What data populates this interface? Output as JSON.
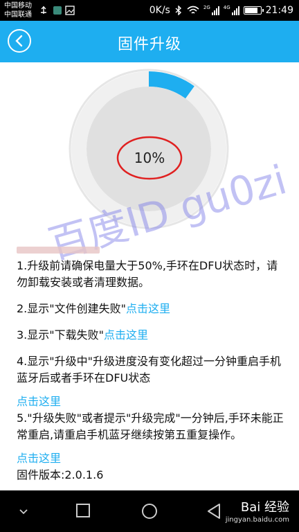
{
  "status_bar": {
    "carrier_1": "中国移动",
    "carrier_2": "中国联通",
    "speed": "0K/s",
    "network_1": "2G",
    "network_2": "4G",
    "time": "21:49",
    "battery_fill": 0.75
  },
  "header": {
    "title": "固件升级",
    "back_icon": "chevron-left-icon",
    "accent_color": "#1eaef0"
  },
  "progress": {
    "label": "10%",
    "value": 0.1,
    "ring_color": "#1eaef0",
    "annotation_color": "#e02020"
  },
  "watermark": "百度ID gu0zi",
  "instructions": {
    "item1": "1.升级前请确保电量大于50%,手环在DFU状态时，请勿卸载安装或者清理数据。",
    "item2_text": "2.显示\"文件创建失败\"",
    "item2_link": "点击这里",
    "item3_text": "3.显示\"下载失败\"",
    "item3_link": "点击这里",
    "item4": "4.显示\"升级中\"升级进度没有变化超过一分钟重启手机蓝牙后或者手环在DFU状态",
    "item4_link": "点击这里",
    "item5": "5.\"升级失败\"或者提示\"升级完成\"一分钟后,手环未能正常重启,请重启手机蓝牙继续按第五重复操作。",
    "item5_link": "点击这里",
    "version": "固件版本:2.0.1.6"
  },
  "navigation": {
    "back_icon": "nav-back-icon",
    "home_icon": "nav-home-icon",
    "recents_icon": "nav-recents-icon",
    "collapse_icon": "nav-collapse-icon"
  },
  "baidu": {
    "brand": "Bai 经验",
    "url": "jingyan.baidu.com"
  }
}
